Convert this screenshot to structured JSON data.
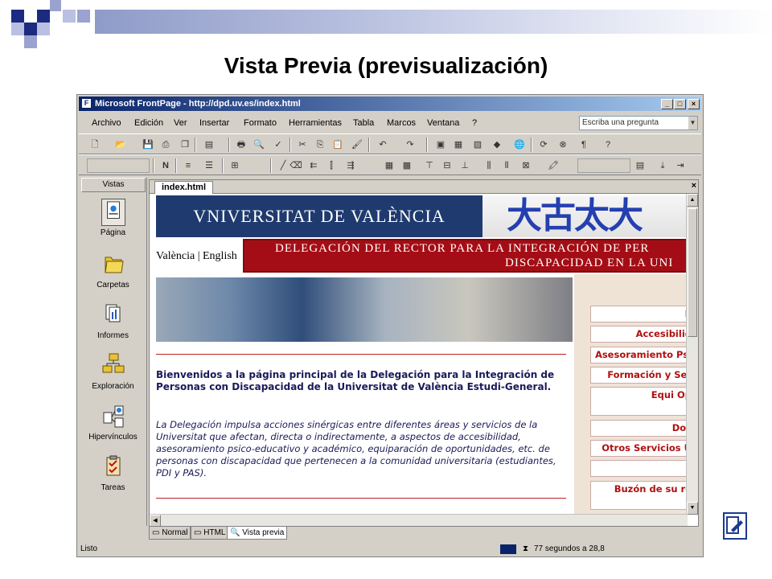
{
  "slide": {
    "title": "Vista Previa (previsualización)",
    "accent_color": "#8f9bc8"
  },
  "window": {
    "title": "Microsoft FrontPage - http://dpd.uv.es/index.html",
    "controls": {
      "minimize": "_",
      "maximize": "□",
      "close": "×"
    },
    "menu": [
      "Archivo",
      "Edición",
      "Ver",
      "Insertar",
      "Formato",
      "Herramientas",
      "Tabla",
      "Marcos",
      "Ventana",
      "?"
    ],
    "ask_placeholder": "Escriba una pregunta"
  },
  "vistas": {
    "header": "Vistas",
    "items": [
      {
        "label": "Página",
        "icon": "page-icon"
      },
      {
        "label": "Carpetas",
        "icon": "folder-icon"
      },
      {
        "label": "Informes",
        "icon": "reports-icon"
      },
      {
        "label": "Exploración",
        "icon": "navigation-icon"
      },
      {
        "label": "Hipervínculos",
        "icon": "hyperlinks-icon"
      },
      {
        "label": "Tareas",
        "icon": "tasks-icon"
      }
    ]
  },
  "document": {
    "tab": "index.html",
    "close": "×"
  },
  "webpage": {
    "uv_logo_text": "VNIVERSITAT DE VALÈNCIA",
    "logo_glyphs": "大古太大",
    "lang": "València | English",
    "banner_line1": "DELEGACIÓN DEL RECTOR PARA LA INTEGRACIÓN DE PER",
    "banner_line2": "DISCAPACIDAD EN LA UNI",
    "welcome": "Bienvenidos a la página principal de la Delegación para la Integración de Personas con Discapacidad de la Universitat de València Estudi-General.",
    "description": "La Delegación impulsa acciones sinérgicas entre diferentes áreas y servicios de la Universitat que afectan, directa o indirectamente, a aspectos de accesibilidad, asesoramiento psico-educativo y académico, equiparación de oportunidades, etc. de personas con discapacidad que pertenecen a la comunidad universitaria (estudiantes, PDI y PAS).",
    "nav": [
      "P",
      "Accesibilid",
      "Asesoramiento Psi",
      "Formación y Ser",
      "Equi Op",
      "Doc",
      "Otros Servicios U",
      "",
      "Buzón de su re"
    ]
  },
  "view_tabs": [
    "Normal",
    "HTML",
    "Vista previa"
  ],
  "status": {
    "left": "Listo",
    "time": "77 segundos a 28,8"
  }
}
